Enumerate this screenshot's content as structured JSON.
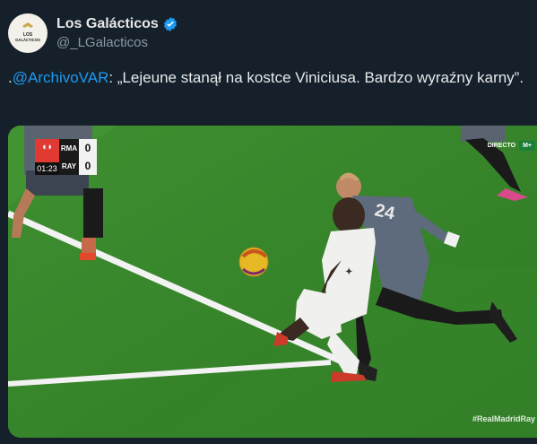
{
  "tweet": {
    "display_name": "Los Galácticos",
    "handle": "@_LGalacticos",
    "avatar_text_top": "LOS",
    "avatar_text_bottom": "GALÁCTICOS",
    "text_prefix": ".",
    "mention": "@ArchivoVAR",
    "text_body": ": „Lejeune stanął na kostce Viniciusa. Bardzo wyraźny karny”."
  },
  "media": {
    "scorebug": {
      "clock": "01:23",
      "home_team": "RMA",
      "home_score": "0",
      "away_team": "RAY",
      "away_score": "0"
    },
    "broadcast_label": "DIRECTO",
    "channel_label": "M+",
    "hashtag": "#RealMadridRay",
    "jersey_number": "24"
  },
  "colors": {
    "background": "#15202b",
    "text": "#e7e9ea",
    "secondary_text": "#8b98a5",
    "link": "#1d9bf0",
    "verified_badge": "#1d9bf0",
    "pitch": "#3f8a2e"
  },
  "icons": [
    "verified-badge-icon",
    "laliga-logo-icon"
  ]
}
